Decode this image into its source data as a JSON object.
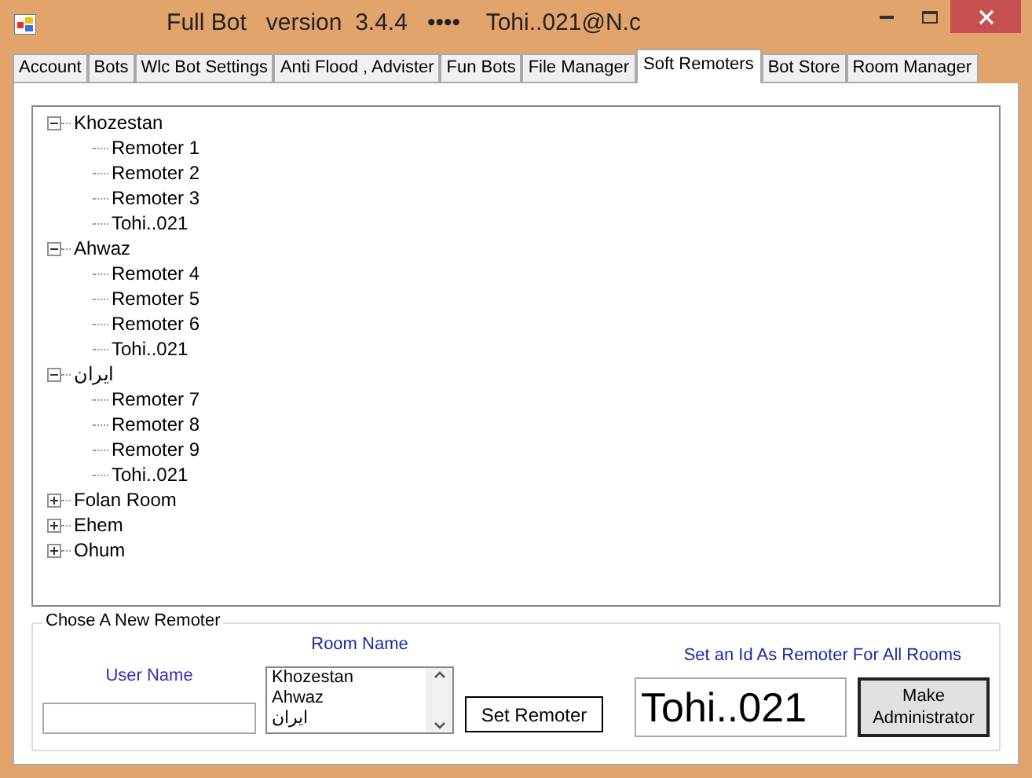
{
  "window": {
    "title": "Full Bot   version  3.4.4   ••••    Tohi..021@N.c"
  },
  "tabs": [
    {
      "label": "Account",
      "selected": false
    },
    {
      "label": "Bots",
      "selected": false
    },
    {
      "label": "Wlc Bot Settings",
      "selected": false
    },
    {
      "label": "Anti Flood , Advister",
      "selected": false
    },
    {
      "label": "Fun Bots",
      "selected": false
    },
    {
      "label": "File Manager",
      "selected": false
    },
    {
      "label": "Soft Remoters",
      "selected": true
    },
    {
      "label": "Bot Store",
      "selected": false
    },
    {
      "label": "Room Manager",
      "selected": false
    }
  ],
  "tree": [
    {
      "label": "Khozestan",
      "expanded": true,
      "children": [
        {
          "label": "Remoter 1"
        },
        {
          "label": "Remoter 2"
        },
        {
          "label": "Remoter 3"
        },
        {
          "label": "Tohi..021"
        }
      ]
    },
    {
      "label": "Ahwaz",
      "expanded": true,
      "children": [
        {
          "label": "Remoter 4"
        },
        {
          "label": "Remoter 5"
        },
        {
          "label": "Remoter 6"
        },
        {
          "label": "Tohi..021"
        }
      ]
    },
    {
      "label": "ایران",
      "expanded": true,
      "children": [
        {
          "label": "Remoter 7"
        },
        {
          "label": "Remoter 8"
        },
        {
          "label": "Remoter 9"
        },
        {
          "label": "Tohi..021"
        }
      ]
    },
    {
      "label": "Folan Room",
      "expanded": false
    },
    {
      "label": "Ehem",
      "expanded": false
    },
    {
      "label": "Ohum",
      "expanded": false
    }
  ],
  "group": {
    "title": "Chose A New Remoter",
    "user_name_label": "User Name",
    "room_name_label": "Room Name",
    "rooms": [
      "Khozestan",
      "Ahwaz",
      "ایران"
    ],
    "set_remoter_button": "Set Remoter",
    "all_rooms_label": "Set an Id As Remoter For All Rooms",
    "admin_id": "Tohi..021",
    "make_admin_button": "Make Administrator"
  }
}
